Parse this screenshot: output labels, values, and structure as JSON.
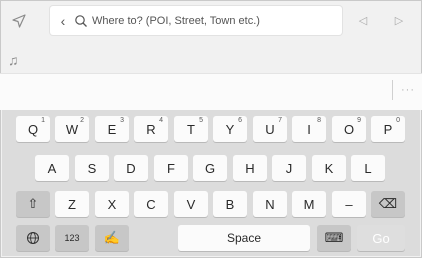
{
  "top_bar": {
    "search_placeholder": "Where to? (POI, Street, Town etc.)",
    "back_icon": "‹",
    "nav_icon": "navigation-arrow",
    "prev_icon": "◁",
    "next_icon": "▷"
  },
  "music_icon": "♫",
  "suggestion_bar": {
    "more_label": "···"
  },
  "keyboard": {
    "row1": [
      {
        "label": "Q",
        "sup": "1"
      },
      {
        "label": "W",
        "sup": "2"
      },
      {
        "label": "E",
        "sup": "3"
      },
      {
        "label": "R",
        "sup": "4"
      },
      {
        "label": "T",
        "sup": "5"
      },
      {
        "label": "Y",
        "sup": "6"
      },
      {
        "label": "U",
        "sup": "7"
      },
      {
        "label": "I",
        "sup": "8"
      },
      {
        "label": "O",
        "sup": "9"
      },
      {
        "label": "P",
        "sup": "0"
      }
    ],
    "row2": [
      "A",
      "S",
      "D",
      "F",
      "G",
      "H",
      "J",
      "K",
      "L"
    ],
    "row3": [
      "Z",
      "X",
      "C",
      "V",
      "B",
      "N",
      "M",
      "–"
    ],
    "shift_icon": "⇧",
    "backspace_icon": "⌫",
    "globe_icon": "🌐",
    "numbers_label": "123",
    "handwriting_icon": "✍",
    "space_label": "Space",
    "keyboard_icon": "⌨",
    "go_label": "Go"
  }
}
